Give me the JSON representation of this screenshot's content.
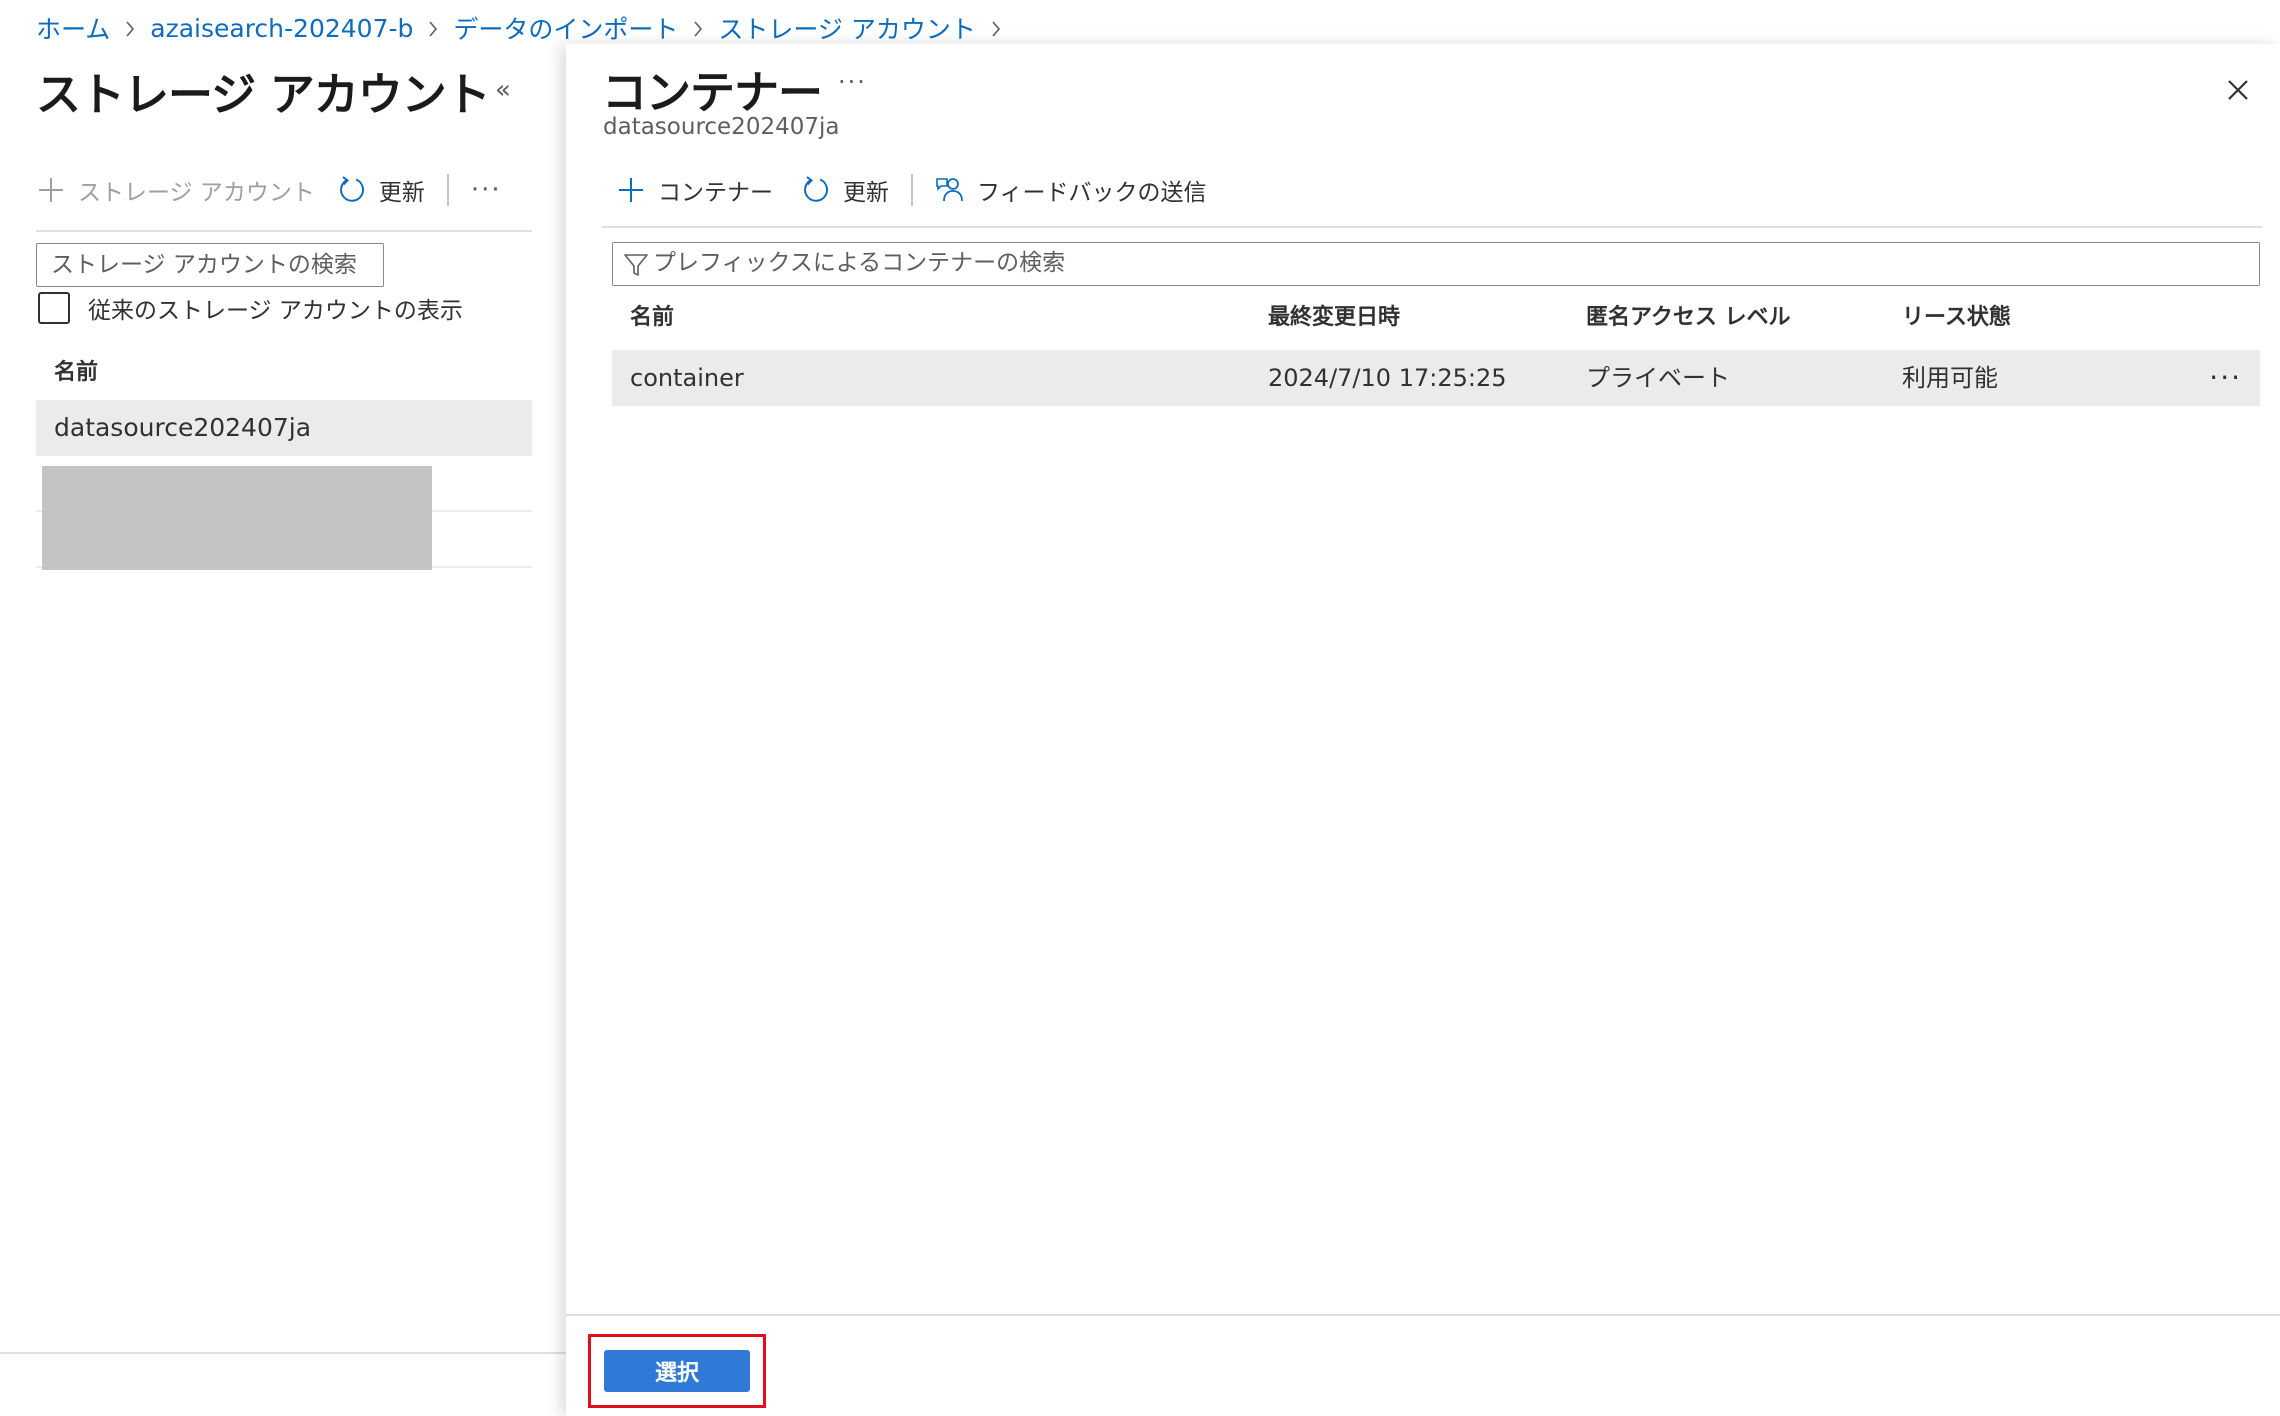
{
  "breadcrumb": {
    "items": [
      "ホーム",
      "azaisearch-202407-b",
      "データのインポート",
      "ストレージ アカウント"
    ]
  },
  "left_panel": {
    "title": "ストレージ アカウント",
    "collapse_icon": "double-chevron-left-icon",
    "toolbar": {
      "add_label": "ストレージ アカウント",
      "refresh_label": "更新",
      "more": "···"
    },
    "search_placeholder": "ストレージ アカウントの検索",
    "checkbox_label": "従来のストレージ アカウントの表示",
    "column_header": "名前",
    "rows": [
      "datasource202407ja"
    ]
  },
  "right_panel": {
    "title": "コンテナー",
    "title_more": "···",
    "subtitle": "datasource202407ja",
    "toolbar": {
      "add_label": "コンテナー",
      "refresh_label": "更新",
      "feedback_label": "フィードバックの送信"
    },
    "search_placeholder": "プレフィックスによるコンテナーの検索",
    "columns": [
      "名前",
      "最終変更日時",
      "匿名アクセス レベル",
      "リース状態"
    ],
    "rows": [
      {
        "name": "container",
        "modified": "2024/7/10 17:25:25",
        "access": "プライベート",
        "lease": "利用可能",
        "more": "···"
      }
    ],
    "select_button": "選択"
  },
  "colors": {
    "accent": "#0f6cbd",
    "primary_button": "#2f7ad6",
    "highlight_border": "#e0101a",
    "selected_row": "#ebebeb"
  }
}
